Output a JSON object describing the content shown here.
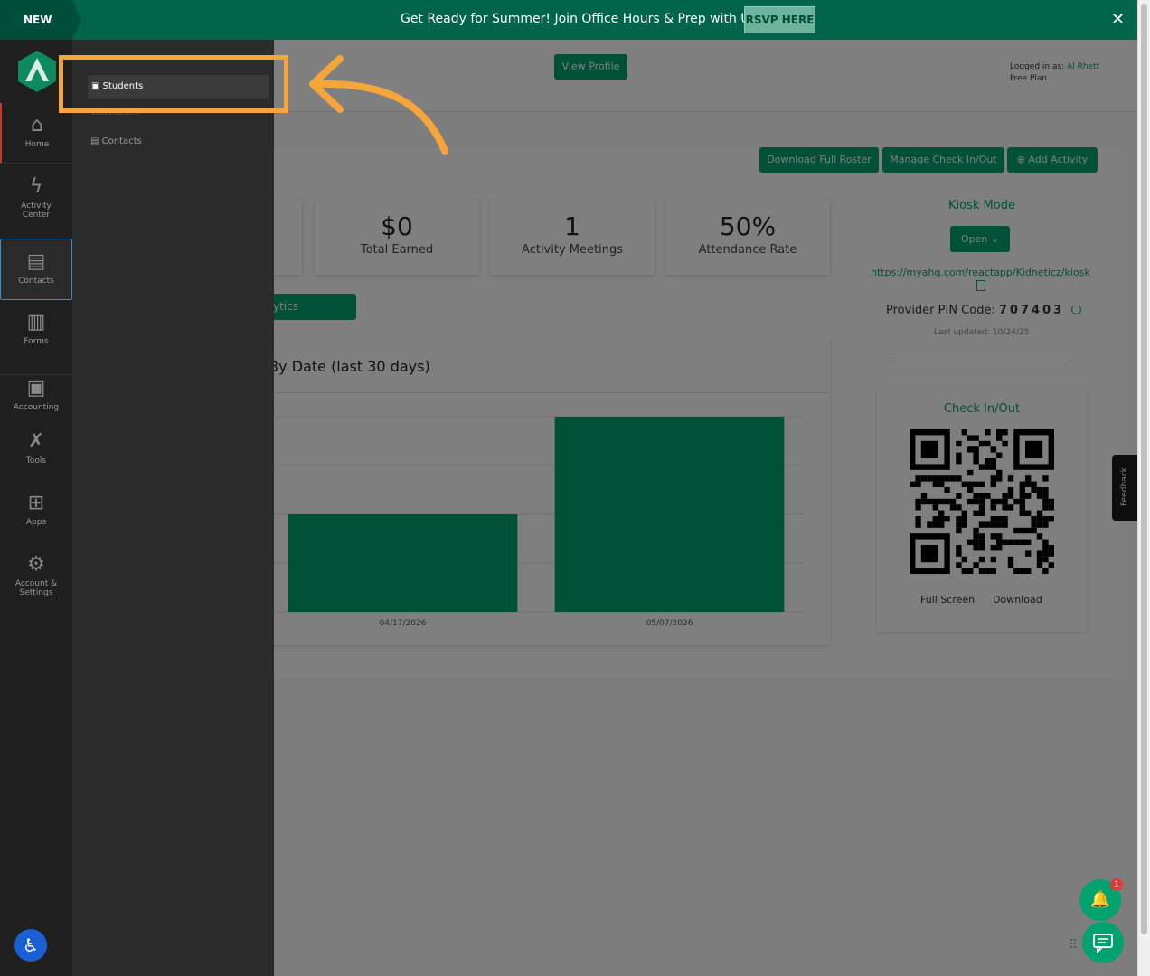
{
  "banner": {
    "tag": "NEW",
    "message": "Get Ready for Summer! Join Office Hours & Prep with Us",
    "rsvp_label": "RSVP HERE",
    "close_glyph": "✕"
  },
  "header": {
    "view_profile_label": "View Profile",
    "logged_in_prefix": "Logged in as:",
    "user_name": "Al Rhett",
    "plan": "Free Plan"
  },
  "actions": {
    "download_roster": "Download Full Roster",
    "manage_checkin": "Manage Check In/Out",
    "add_activity": "Add Activity"
  },
  "stats": [
    {
      "value": "$0",
      "label": "Total Earned"
    },
    {
      "value": "1",
      "label": "Activity Meetings"
    },
    {
      "value": "50%",
      "label": "Attendance Rate"
    }
  ],
  "analytics_label": "ytics",
  "chart_data": {
    "type": "bar",
    "title": "By Date (last 30 days)",
    "title_visible": "3y Date (last 30 days)",
    "categories": [
      "04/17/2026",
      "05/07/2026"
    ],
    "values": [
      1,
      2
    ],
    "ylim": [
      0,
      2
    ],
    "grid": true,
    "xlabel": "",
    "ylabel": ""
  },
  "kiosk": {
    "title": "Kiosk Mode",
    "open_label": "Open ⌄",
    "url": "https://myahq.com/reactapp/Kidneticz/kiosk",
    "pin_label": "Provider PIN Code:",
    "pin_code": "707403",
    "last_updated": "Last updated: 10/24/25"
  },
  "checkin": {
    "title": "Check In/Out",
    "full_screen": "Full Screen",
    "download": "Download"
  },
  "feedback_label": "Feedback",
  "notification_count": "1",
  "nav": {
    "home": "Home",
    "activity_center_1": "Activity",
    "activity_center_2": "Center",
    "contacts": "Contacts",
    "forms": "Forms",
    "accounting": "Accounting",
    "tools": "Tools",
    "apps": "Apps",
    "account_1": "Account &",
    "account_2": "Settings"
  },
  "submenu": {
    "students": "Students",
    "volunteers": "Volunteers",
    "contacts": "Contacts"
  },
  "colors": {
    "brand_green": "#00a36f",
    "banner_green": "#00654a",
    "highlight_orange": "#f5a63b"
  }
}
